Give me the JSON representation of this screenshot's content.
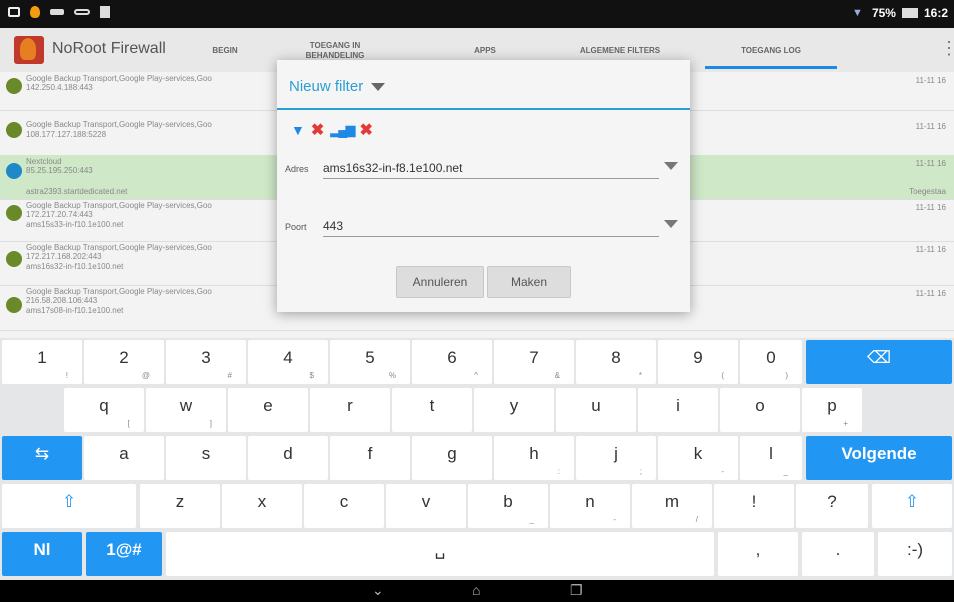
{
  "statusbar": {
    "battery": "75%",
    "time": "16:2"
  },
  "app": {
    "title": "NoRoot Firewall"
  },
  "tabs": [
    "BEGIN",
    "TOEGANG IN BEHANDELING",
    "APPS",
    "ALGEMENE FILTERS",
    "TOEGANG LOG"
  ],
  "rows": [
    {
      "line1": "Google Backup Transport,Google Play-services,Goo",
      "line2": "142.250.4.188:443",
      "line3": "",
      "time": "11-11 16",
      "label": ""
    },
    {
      "line1": "Google Backup Transport,Google Play-services,Goo",
      "line2": "108.177.127.188:5228",
      "line3": "",
      "time": "11-11 16",
      "label": ""
    },
    {
      "line1": "Nextcloud",
      "line2": "85.25.195.250:443",
      "line3": "astra2393.startdedicated.net",
      "time": "11-11 16",
      "label": "Toegestaa"
    },
    {
      "line1": "Google Backup Transport,Google Play-services,Goo",
      "line2": "172.217.20.74:443",
      "line3": "ams15s33-in-f10.1e100.net",
      "time": "11-11 16",
      "label": ""
    },
    {
      "line1": "Google Backup Transport,Google Play-services,Goo",
      "line2": "172.217.168.202:443",
      "line3": "ams16s32-in-f10.1e100.net",
      "time": "11-11 16",
      "label": ""
    },
    {
      "line1": "Google Backup Transport,Google Play-services,Goo",
      "line2": "216.58.208.106:443",
      "line3": "ams17s08-in-f10.1e100.net",
      "time": "11-11 16",
      "label": ""
    }
  ],
  "dialog": {
    "title": "Nieuw filter",
    "adres_label": "Adres",
    "adres_value": "ams16s32-in-f8.1e100.net",
    "poort_label": "Poort",
    "poort_value": "443",
    "cancel": "Annuleren",
    "create": "Maken"
  },
  "keyboard": {
    "row1": [
      {
        "k": "1",
        "s": "!"
      },
      {
        "k": "2",
        "s": "@"
      },
      {
        "k": "3",
        "s": "#"
      },
      {
        "k": "4",
        "s": "$"
      },
      {
        "k": "5",
        "s": "%"
      },
      {
        "k": "6",
        "s": "^"
      },
      {
        "k": "7",
        "s": "&"
      },
      {
        "k": "8",
        "s": "*"
      },
      {
        "k": "9",
        "s": "("
      },
      {
        "k": "0",
        "s": ")"
      }
    ],
    "row2": [
      {
        "k": "q",
        "s": "["
      },
      {
        "k": "w",
        "s": "]"
      },
      {
        "k": "e",
        "s": ""
      },
      {
        "k": "r",
        "s": ""
      },
      {
        "k": "t",
        "s": ""
      },
      {
        "k": "y",
        "s": ""
      },
      {
        "k": "u",
        "s": ""
      },
      {
        "k": "i",
        "s": ""
      },
      {
        "k": "o",
        "s": ""
      },
      {
        "k": "p",
        "s": "+"
      }
    ],
    "row3": [
      {
        "k": "a",
        "s": ""
      },
      {
        "k": "s",
        "s": ""
      },
      {
        "k": "d",
        "s": ""
      },
      {
        "k": "f",
        "s": ""
      },
      {
        "k": "g",
        "s": ""
      },
      {
        "k": "h",
        "s": ":"
      },
      {
        "k": "j",
        "s": ";"
      },
      {
        "k": "k",
        "s": "-"
      },
      {
        "k": "l",
        "s": "_"
      }
    ],
    "row4": [
      {
        "k": "z",
        "s": ""
      },
      {
        "k": "x",
        "s": ""
      },
      {
        "k": "c",
        "s": ""
      },
      {
        "k": "v",
        "s": ""
      },
      {
        "k": "b",
        "s": "_"
      },
      {
        "k": "n",
        "s": "-"
      },
      {
        "k": "m",
        "s": "/"
      },
      {
        "k": "!",
        "s": ""
      },
      {
        "k": "?",
        "s": ""
      }
    ],
    "enter_label": "Volgende",
    "lang_label": "Nl",
    "symbols_label": "1@#",
    "comma": ",",
    "period": ".",
    "smiley": ":-)"
  }
}
